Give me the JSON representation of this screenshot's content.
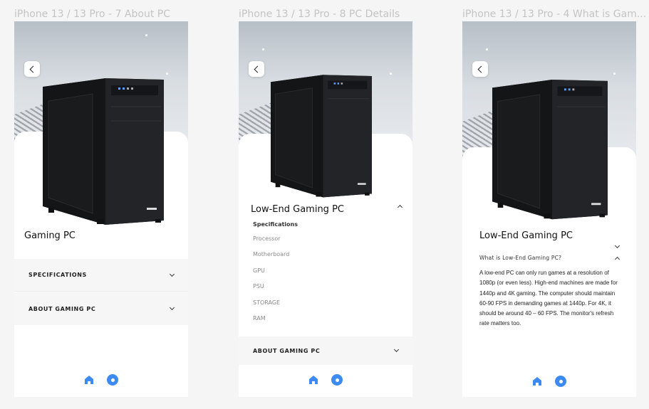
{
  "frames": [
    {
      "title": "iPhone 13 / 13 Pro - 7 About PC",
      "product_title": "Gaming PC",
      "accordion": [
        {
          "label": "SPECIFICATIONS"
        },
        {
          "label": "ABOUT GAMING PC"
        }
      ]
    },
    {
      "title": "iPhone 13 / 13 Pro - 8 PC Details",
      "product_title": "Low-End Gaming PC",
      "specs_heading": "Specifications",
      "specs": [
        "Processor",
        "Motherboard",
        "GPU",
        "PSU",
        "STORAGE",
        "RAM"
      ],
      "accordion": [
        {
          "label": "ABOUT GAMING PC"
        }
      ]
    },
    {
      "title": "iPhone 13 / 13 Pro - 4 What is Gam...",
      "product_title": "Low-End Gaming PC",
      "question": "What is Low-End Gaming PC?",
      "answer": "A low-end PC can only run games at a resolution of 1080p (or even less). High-end machines are made for 1440p and 4K gaming. The computer should maintain 60-90 FPS in demanding games at 1440p. For 4K, it should be around 40 – 60 FPS. The monitor's refresh rate matters too."
    }
  ],
  "colors": {
    "accent": "#3d8bf2",
    "tower": "#1c1d1f",
    "panel": "#f6f6f6"
  },
  "icons": [
    "back-arrow-icon",
    "chevron-down-icon",
    "chevron-up-icon",
    "home-icon",
    "circle-button-icon"
  ]
}
